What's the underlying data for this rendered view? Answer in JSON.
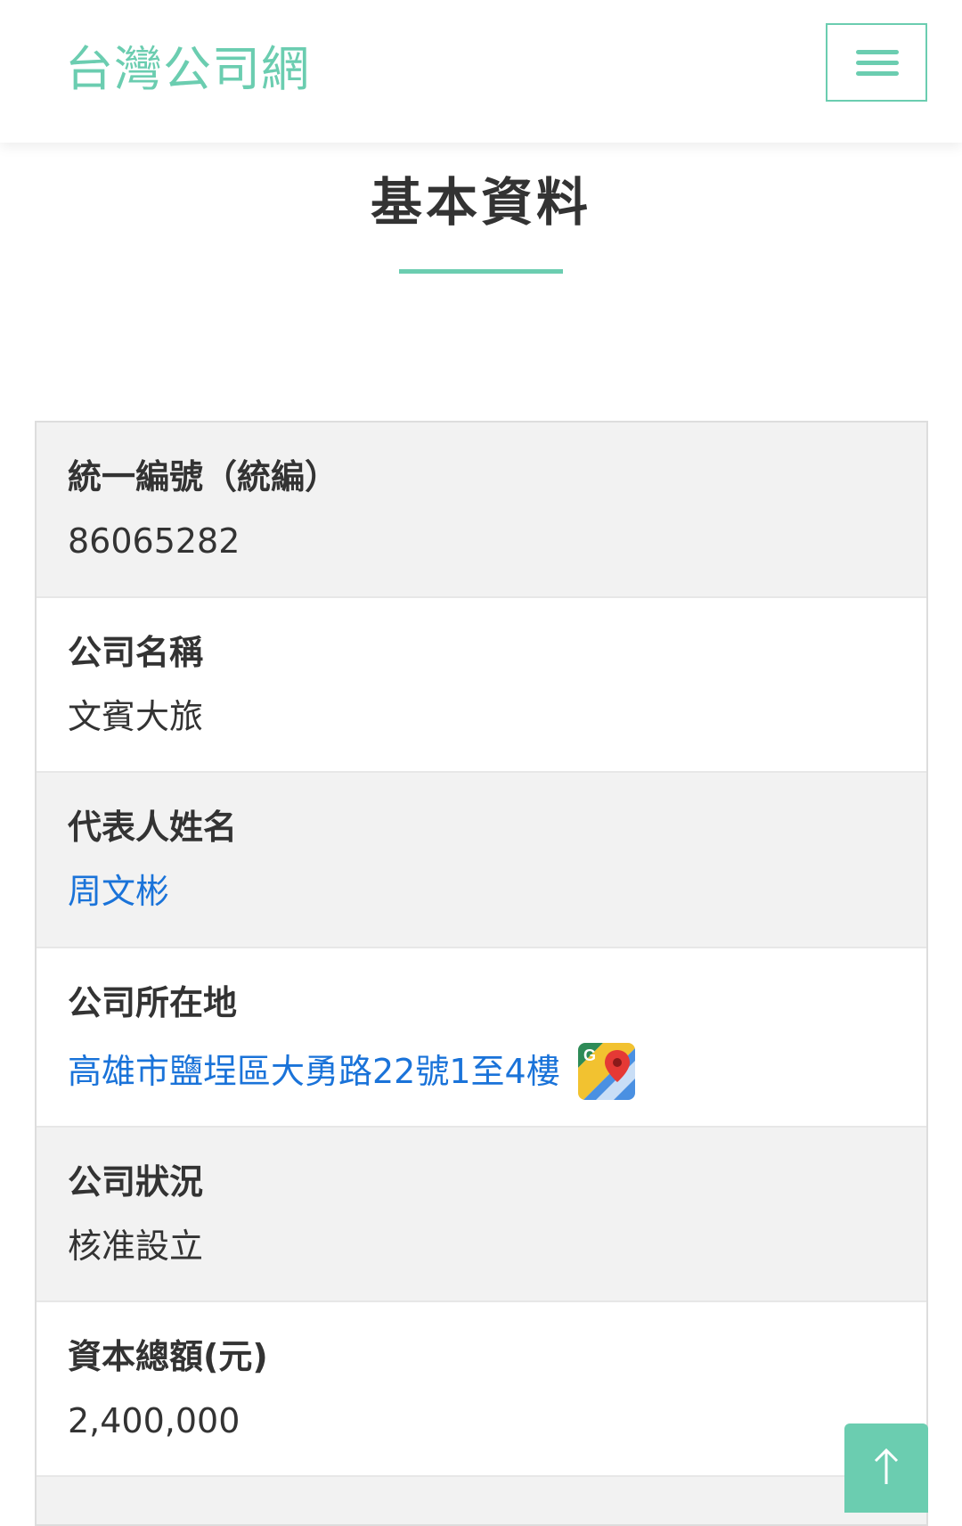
{
  "header": {
    "brand": "台灣公司網",
    "menu_icon": "hamburger-menu-icon"
  },
  "section": {
    "title": "基本資料"
  },
  "rows": [
    {
      "label": "統一編號（統編）",
      "value": "86065282"
    },
    {
      "label": "公司名稱",
      "value": "文賓大旅"
    },
    {
      "label": "代表人姓名",
      "value": "周文彬"
    },
    {
      "label": "公司所在地",
      "value": "高雄市鹽埕區大勇路22號1至4樓",
      "icon": "google-maps-icon"
    },
    {
      "label": "公司狀況",
      "value": "核准設立"
    },
    {
      "label": "資本總額(元)",
      "value": "2,400,000"
    }
  ],
  "back_to_top_icon": "arrow-up-icon",
  "colors": {
    "accent": "#6bcdb0",
    "link": "#1a73d9",
    "row_shade": "#f2f2f2",
    "text": "#333333"
  }
}
